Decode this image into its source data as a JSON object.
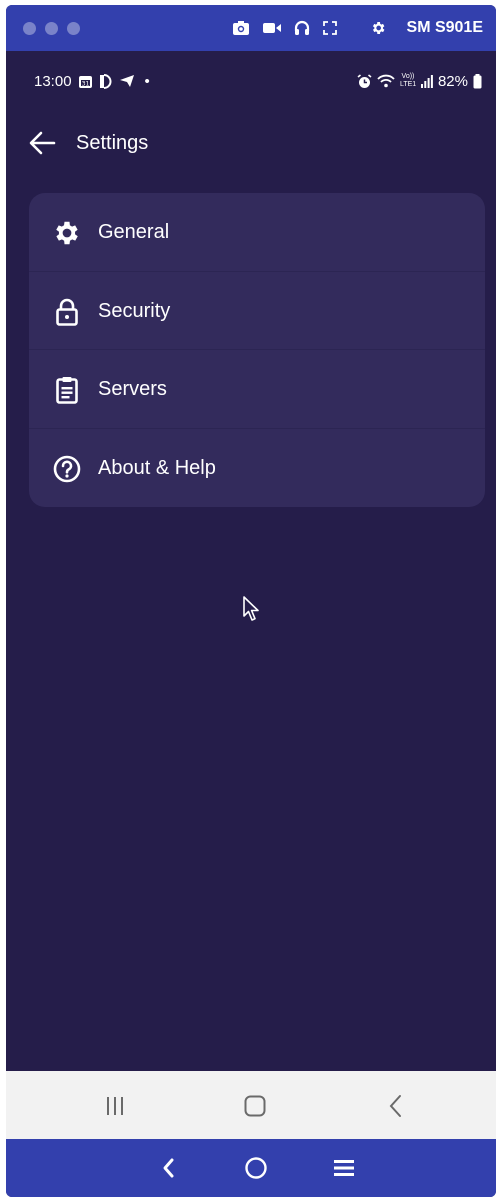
{
  "emulator": {
    "device_name": "SM S901E"
  },
  "status_bar": {
    "time": "13:00",
    "dot": "•",
    "lte_label": "Vo)) LTE1",
    "battery": "82%"
  },
  "app_bar": {
    "title": "Settings"
  },
  "settings": {
    "items": [
      {
        "label": "General",
        "icon": "gear-icon"
      },
      {
        "label": "Security",
        "icon": "lock-icon"
      },
      {
        "label": "Servers",
        "icon": "clipboard-icon"
      },
      {
        "label": "About & Help",
        "icon": "help-circle-icon"
      }
    ]
  },
  "colors": {
    "background": "#251d4a",
    "card": "#332b5c",
    "emulator_bar": "#3340ad",
    "nav_bar": "#f2f2f2"
  }
}
